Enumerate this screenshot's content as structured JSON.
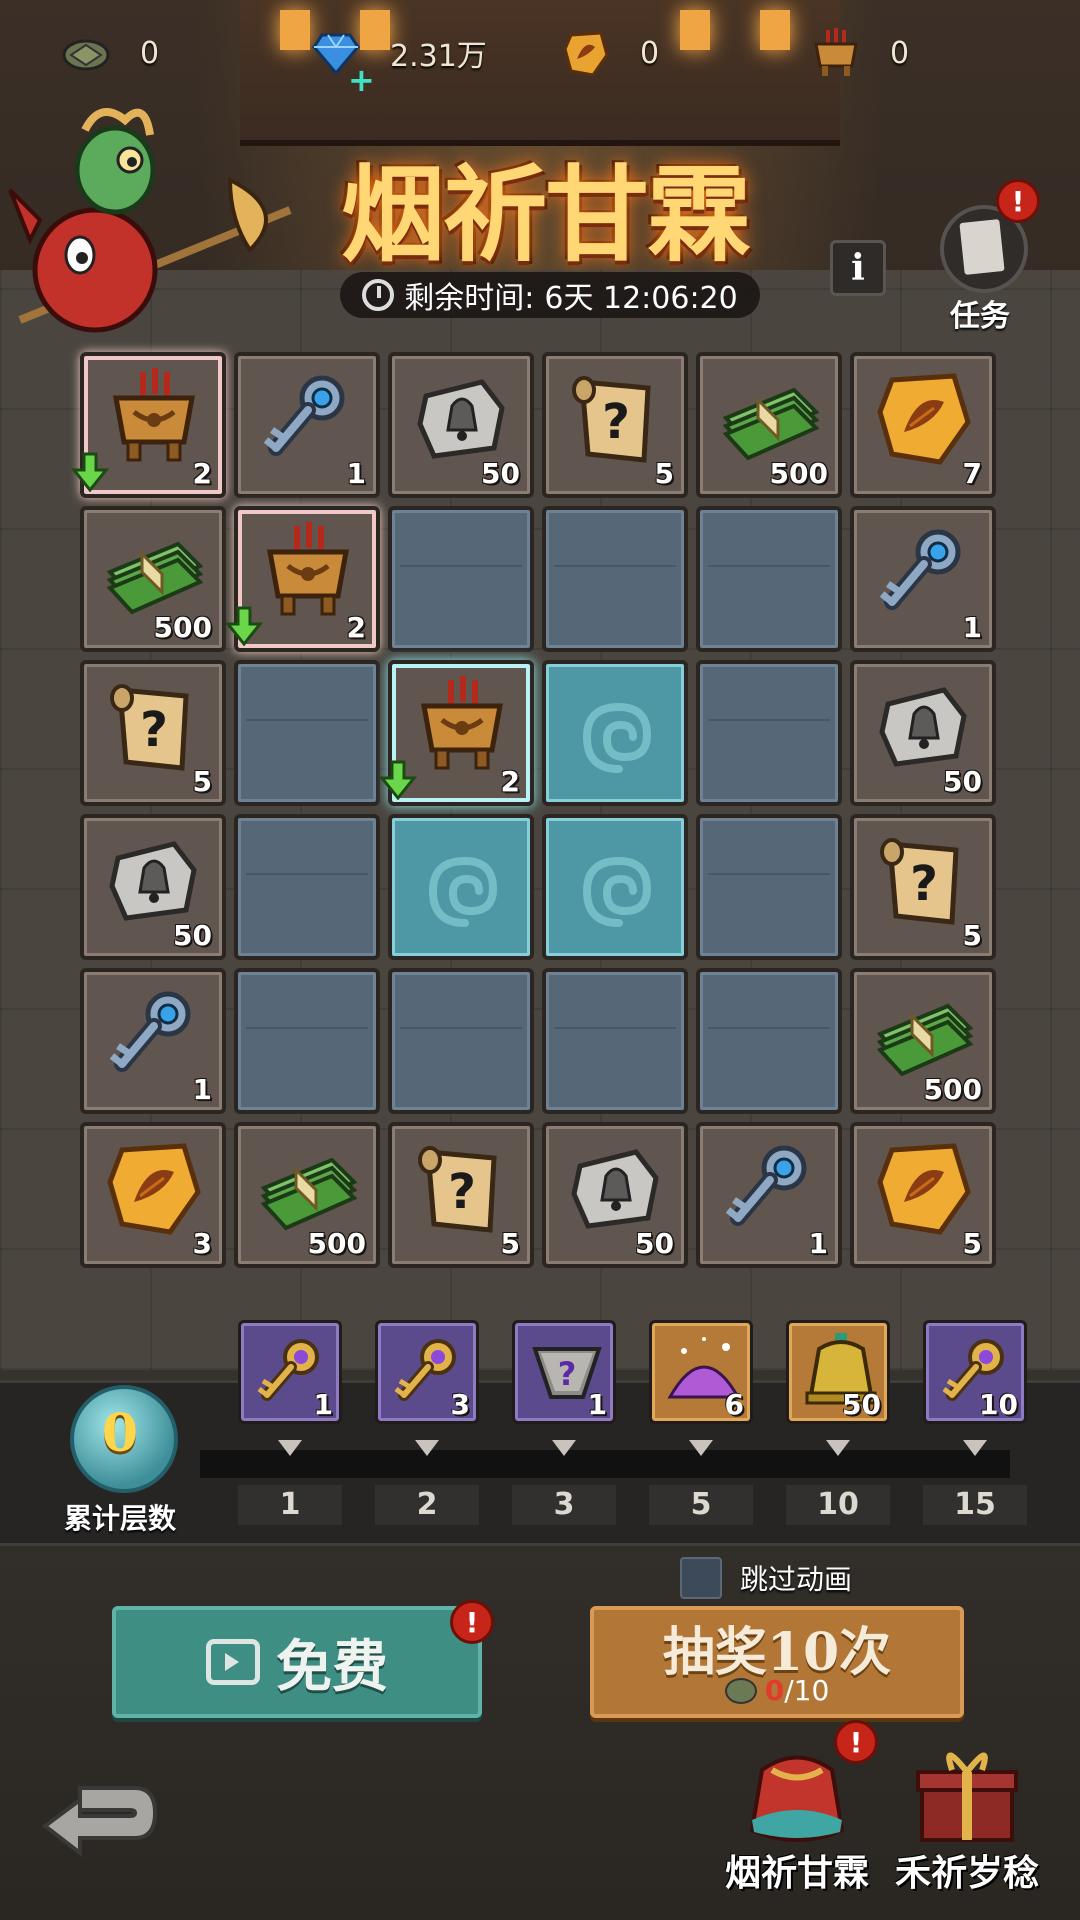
{
  "currencies": [
    {
      "icon": "turtle-shell-icon",
      "value": "0"
    },
    {
      "icon": "diamond-icon",
      "value": "2.31万"
    },
    {
      "icon": "amber-token-icon",
      "value": "0"
    },
    {
      "icon": "incense-burner-icon",
      "value": "0"
    }
  ],
  "event": {
    "title": "烟祈甘霖",
    "timer_label": "剩余时间:",
    "timer_value": "6天 12:06:20",
    "info_label": "i",
    "task_label": "任务"
  },
  "grid": [
    [
      {
        "item": "incense-burner",
        "count": "2",
        "glow": "pink",
        "arrow": true
      },
      {
        "item": "key",
        "count": "1"
      },
      {
        "item": "bell-scroll",
        "count": "50"
      },
      {
        "item": "mystery-scroll",
        "count": "5"
      },
      {
        "item": "cash",
        "count": "500"
      },
      {
        "item": "amber",
        "count": "7"
      }
    ],
    [
      {
        "item": "cash",
        "count": "500"
      },
      {
        "item": "incense-burner",
        "count": "2",
        "glow": "pink",
        "arrow": true
      },
      {
        "item": "empty"
      },
      {
        "item": "empty"
      },
      {
        "item": "empty"
      },
      {
        "item": "key",
        "count": "1"
      }
    ],
    [
      {
        "item": "mystery-scroll",
        "count": "5"
      },
      {
        "item": "empty"
      },
      {
        "item": "incense-burner",
        "count": "2",
        "glow": "cyan",
        "arrow": true
      },
      {
        "item": "cloud"
      },
      {
        "item": "empty"
      },
      {
        "item": "bell-scroll",
        "count": "50"
      }
    ],
    [
      {
        "item": "bell-scroll",
        "count": "50"
      },
      {
        "item": "empty"
      },
      {
        "item": "cloud"
      },
      {
        "item": "cloud"
      },
      {
        "item": "empty"
      },
      {
        "item": "mystery-scroll",
        "count": "5"
      }
    ],
    [
      {
        "item": "key",
        "count": "1"
      },
      {
        "item": "empty"
      },
      {
        "item": "empty"
      },
      {
        "item": "empty"
      },
      {
        "item": "empty"
      },
      {
        "item": "cash",
        "count": "500"
      }
    ],
    [
      {
        "item": "amber",
        "count": "3"
      },
      {
        "item": "cash",
        "count": "500"
      },
      {
        "item": "mystery-scroll",
        "count": "5"
      },
      {
        "item": "bell-scroll",
        "count": "50"
      },
      {
        "item": "key",
        "count": "1"
      },
      {
        "item": "amber",
        "count": "5"
      }
    ]
  ],
  "progress": {
    "layers_value": "0",
    "layers_label": "累计层数",
    "milestones": [
      {
        "item": "gold-key",
        "count": "1",
        "level": "1",
        "frame": "purple"
      },
      {
        "item": "gold-key",
        "count": "3",
        "level": "2",
        "frame": "purple"
      },
      {
        "item": "mystery-stone",
        "count": "1",
        "level": "3",
        "frame": "purple"
      },
      {
        "item": "purple-powder",
        "count": "6",
        "level": "5",
        "frame": "orange"
      },
      {
        "item": "golden-bell",
        "count": "50",
        "level": "10",
        "frame": "orange"
      },
      {
        "item": "gold-key",
        "count": "10",
        "level": "15",
        "frame": "purple"
      }
    ]
  },
  "actions": {
    "skip_label": "跳过动画",
    "free_label": "免费",
    "draw_label": "抽奖10次",
    "draw_cost_have": "0",
    "draw_cost_need": "/10"
  },
  "nav": {
    "tab1": "烟祈甘霖",
    "tab2": "禾祈岁稔"
  },
  "colors": {
    "empty_cell": "#566778",
    "cloud_cell": "#4d98a4",
    "filled_cell": "#61564f",
    "free_button": "#3f8e84",
    "draw_button": "#b27737",
    "alert": "#c8251a"
  }
}
